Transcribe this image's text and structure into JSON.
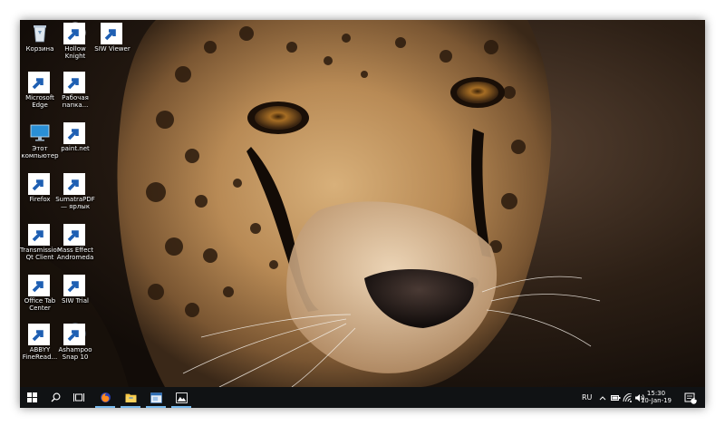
{
  "desktop": {
    "icons": [
      {
        "name": "recycle-bin",
        "label": "Корзина"
      },
      {
        "name": "hollow-knight",
        "label": "Hollow\nKnight"
      },
      {
        "name": "siw-viewer",
        "label": "SIW Viewer"
      },
      {
        "name": "microsoft-edge",
        "label": "Microsoft\nEdge"
      },
      {
        "name": "desktop-folder",
        "label": "Рабочая\nпапка..."
      },
      {
        "name": "this-pc",
        "label": "Этот\nкомпьютер"
      },
      {
        "name": "paint-net",
        "label": "paint.net"
      },
      {
        "name": "firefox",
        "label": "Firefox"
      },
      {
        "name": "sumatrapdf",
        "label": "SumatraPDF\n— ярлык"
      },
      {
        "name": "transmission",
        "label": "Transmission\nQt Client"
      },
      {
        "name": "mass-effect",
        "label": "Mass Effect\nAndromeda"
      },
      {
        "name": "office-tab-center",
        "label": "Office Tab\nCenter"
      },
      {
        "name": "siw-trial",
        "label": "SIW Trial"
      },
      {
        "name": "abbyy-finereader",
        "label": "ABBYY\nFineRead..."
      },
      {
        "name": "ashampoo-snap",
        "label": "Ashampoo\nSnap 10"
      }
    ]
  },
  "taskbar": {
    "language": "RU",
    "time": "15:30",
    "date": "10-Jan-19",
    "notification_count": "1"
  },
  "colors": {
    "taskbar_bg": "#101214",
    "active_indicator": "#76b9ed",
    "accent": "#1e88e5"
  }
}
